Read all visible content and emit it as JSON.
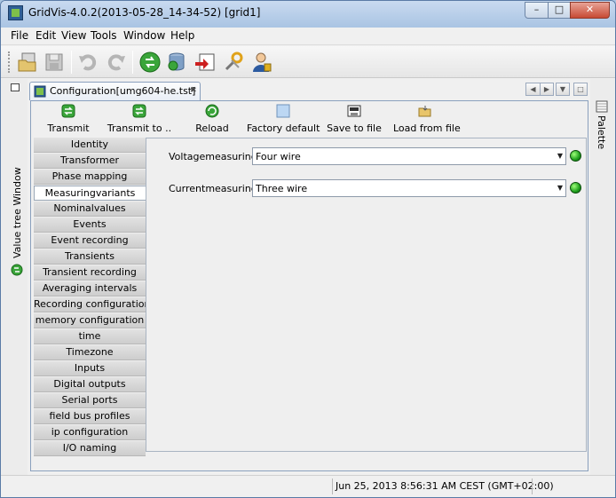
{
  "window": {
    "title": "GridVis-4.0.2(2013-05-28_14-34-52) [grid1]"
  },
  "menu": {
    "items": [
      "File",
      "Edit",
      "View",
      "Tools",
      "Window",
      "Help"
    ]
  },
  "toolbar": {
    "icons": [
      "open-project-icon",
      "save-icon",
      "undo-icon",
      "redo-icon",
      "transmit-icon",
      "database-icon",
      "import-icon",
      "tools-icon",
      "user-icon"
    ]
  },
  "side": {
    "left_label": "Value tree Window",
    "right_label": "Palette"
  },
  "editor": {
    "tab_label": "Configuration[umg604-he.tst]"
  },
  "actions": {
    "transmit": "Transmit",
    "transmit_to": "Transmit to ..",
    "reload": "Reload",
    "factory_default": "Factory default",
    "save_to_file": "Save to file",
    "load_from_file": "Load from file"
  },
  "nav_list": {
    "items": [
      "Identity",
      "Transformer",
      "Phase mapping",
      "Measuringvariants",
      "Nominalvalues",
      "Events",
      "Event recording",
      "Transients",
      "Transient recording",
      "Averaging intervals",
      "Recording configuration",
      "memory configuration",
      "time",
      "Timezone",
      "Inputs",
      "Digital outputs",
      "Serial ports",
      "field bus profiles",
      "ip configuration",
      "I/O naming"
    ],
    "selected": "Measuringvariants"
  },
  "form": {
    "voltage_label": "Voltagemeasuring",
    "voltage_value": "Four wire",
    "current_label": "Currentmeasuring",
    "current_value": "Three wire"
  },
  "status": {
    "datetime": "Jun 25, 2013 8:56:31 AM CEST (GMT+02:00)"
  },
  "colors": {
    "accent_green": "#1e9e1c",
    "titlebar": "#a9c4e3",
    "close_red": "#c74a34"
  }
}
